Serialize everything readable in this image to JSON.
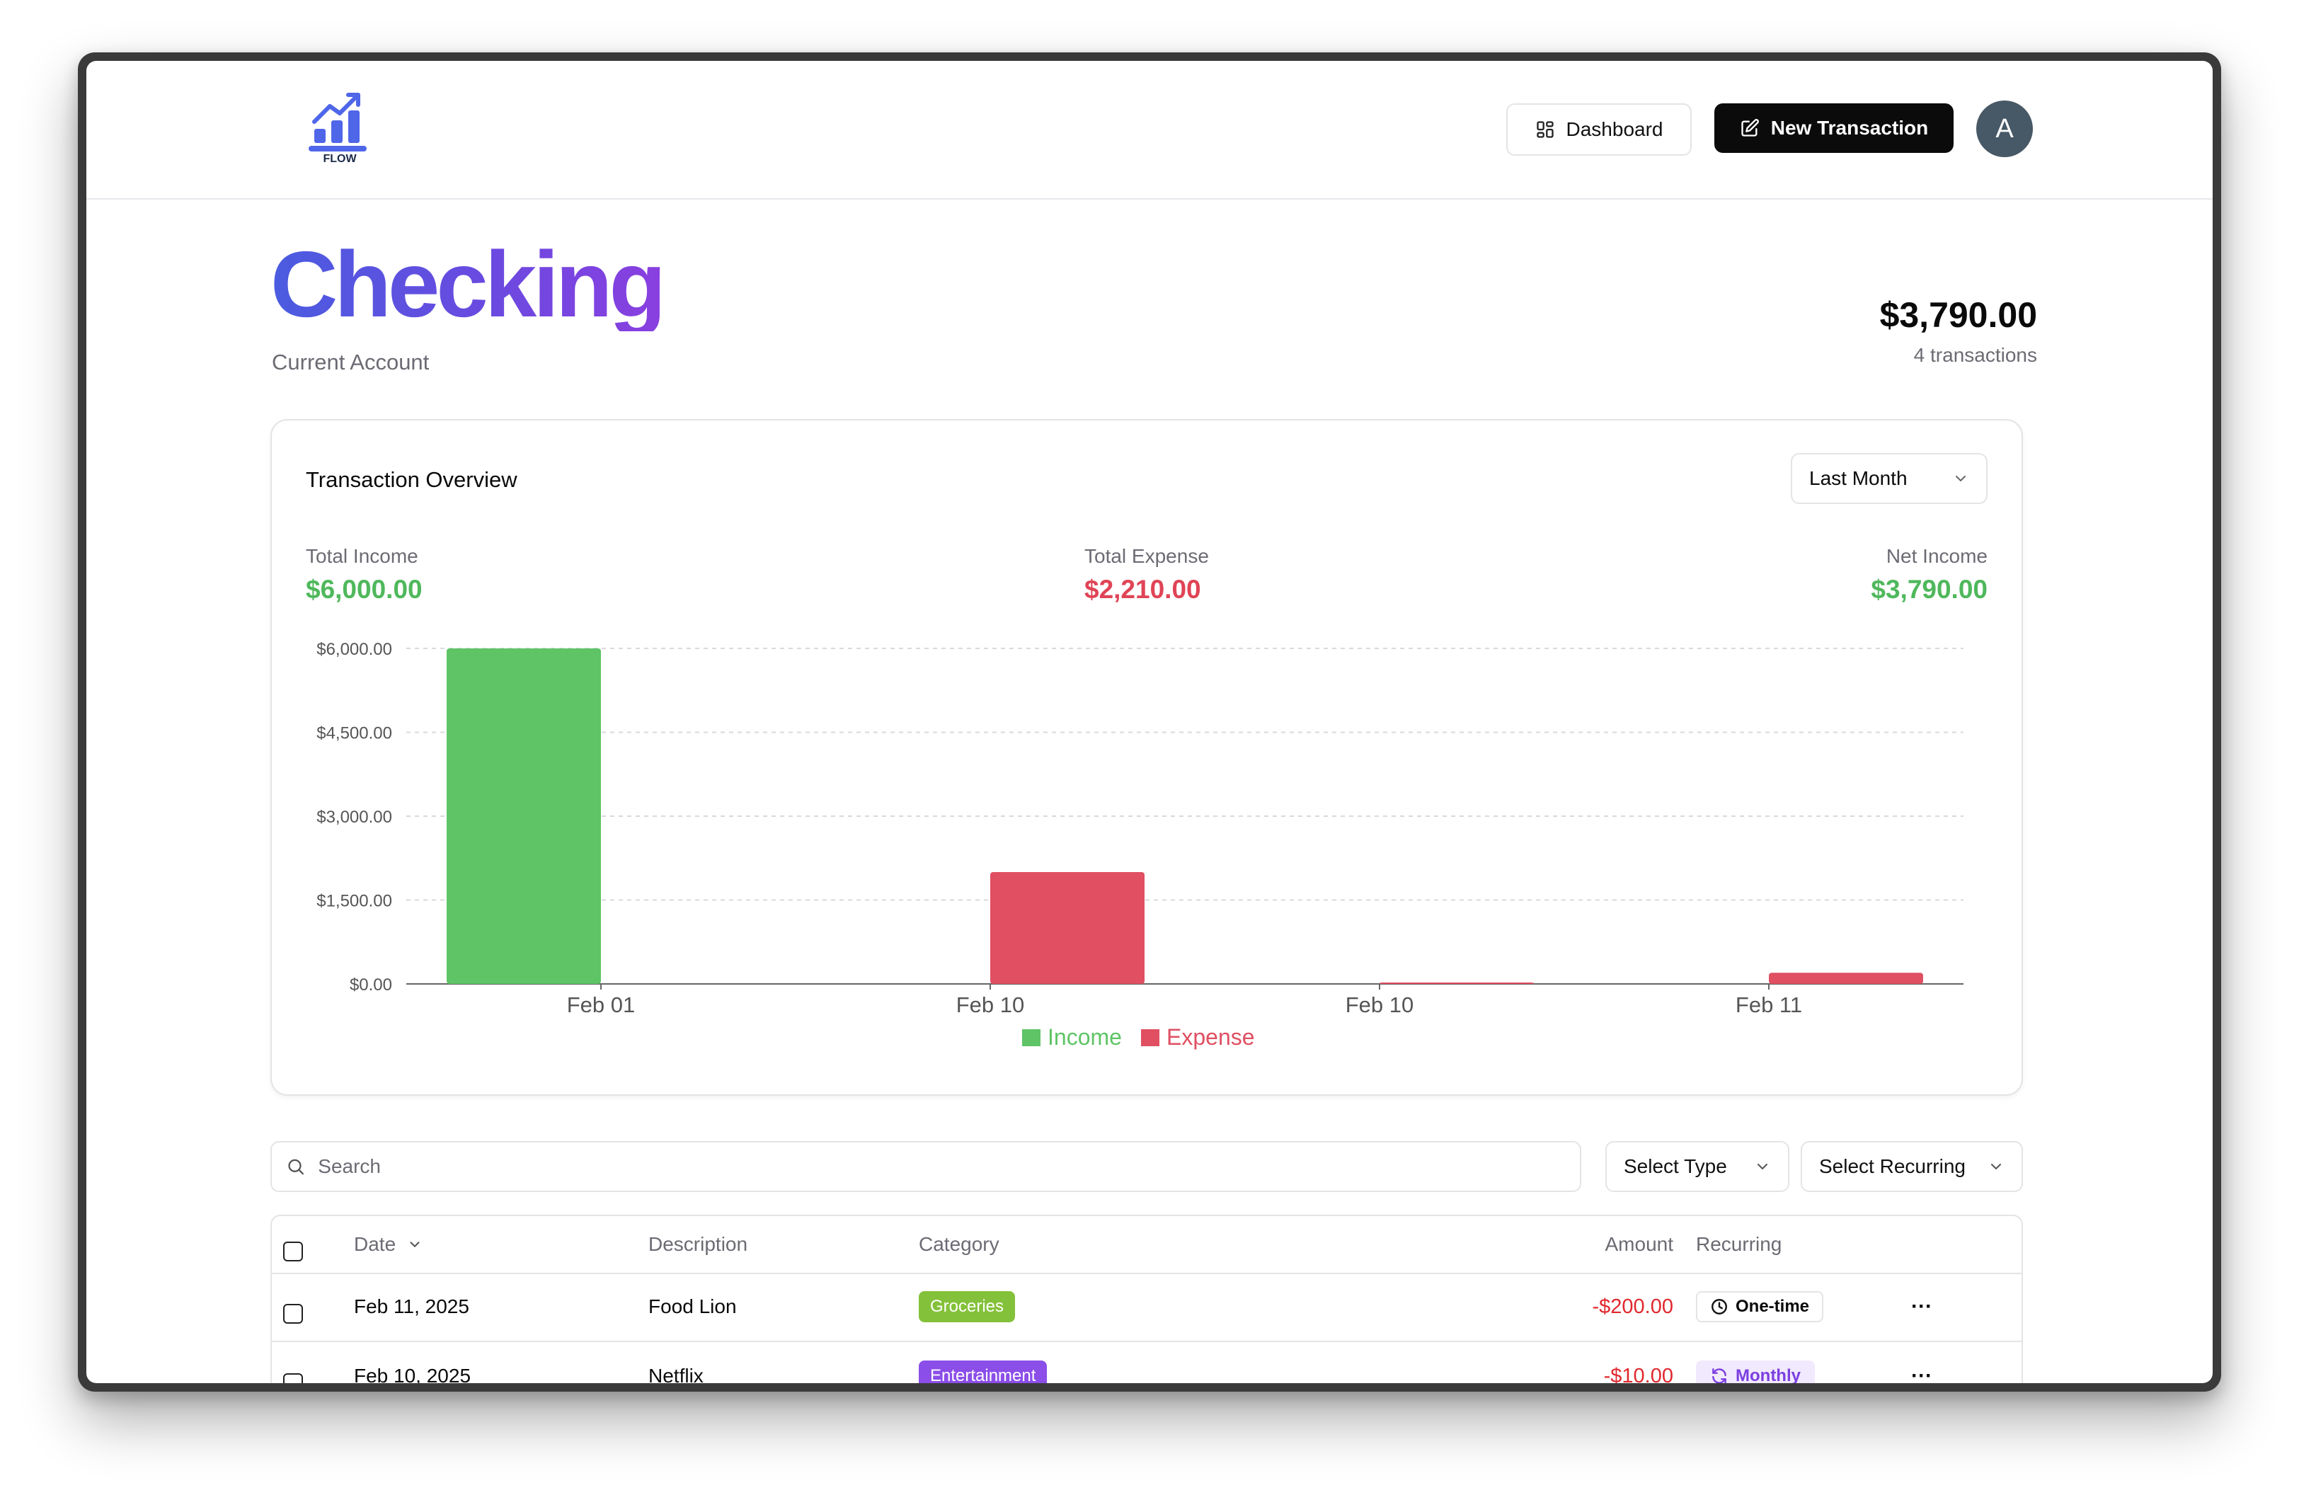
{
  "header": {
    "logo_text": "FLOW",
    "dashboard_label": "Dashboard",
    "new_transaction_label": "New Transaction",
    "avatar_initial": "A"
  },
  "account": {
    "name": "Checking",
    "type": "Current Account",
    "balance": "$3,790.00",
    "transaction_count": "4 transactions"
  },
  "overview": {
    "title": "Transaction Overview",
    "period": "Last Month",
    "total_income_label": "Total Income",
    "total_income": "$6,000.00",
    "total_expense_label": "Total Expense",
    "total_expense": "$2,210.00",
    "net_income_label": "Net Income",
    "net_income": "$3,790.00"
  },
  "chart_data": {
    "type": "bar",
    "categories": [
      "Feb 01",
      "Feb 10",
      "Feb 10",
      "Feb 11"
    ],
    "series": [
      {
        "name": "Income",
        "color": "#5ec466",
        "values": [
          6000,
          0,
          0,
          0
        ]
      },
      {
        "name": "Expense",
        "color": "#e04f62",
        "values": [
          0,
          2000,
          10,
          200
        ]
      }
    ],
    "y_ticks": [
      "$0.00",
      "$1,500.00",
      "$3,000.00",
      "$4,500.00",
      "$6,000.00"
    ],
    "ylim": [
      0,
      6000
    ],
    "grid": true,
    "legend": "bottom-center"
  },
  "filters": {
    "search_placeholder": "Search",
    "type_select": "Select Type",
    "recurring_select": "Select Recurring"
  },
  "table": {
    "columns": {
      "date": "Date",
      "description": "Description",
      "category": "Category",
      "amount": "Amount",
      "recurring": "Recurring"
    },
    "rows": [
      {
        "date": "Feb 11, 2025",
        "description": "Food Lion",
        "category": "Groceries",
        "category_color": "#84c13a",
        "amount": "-$200.00",
        "recurring": "One-time",
        "recurring_icon": "clock-icon"
      },
      {
        "date": "Feb 10, 2025",
        "description": "Netflix",
        "category": "Entertainment",
        "category_color": "#8b4ee8",
        "amount": "-$10.00",
        "recurring": "Monthly",
        "recurring_icon": "refresh-icon"
      }
    ],
    "row_menu": "···"
  }
}
